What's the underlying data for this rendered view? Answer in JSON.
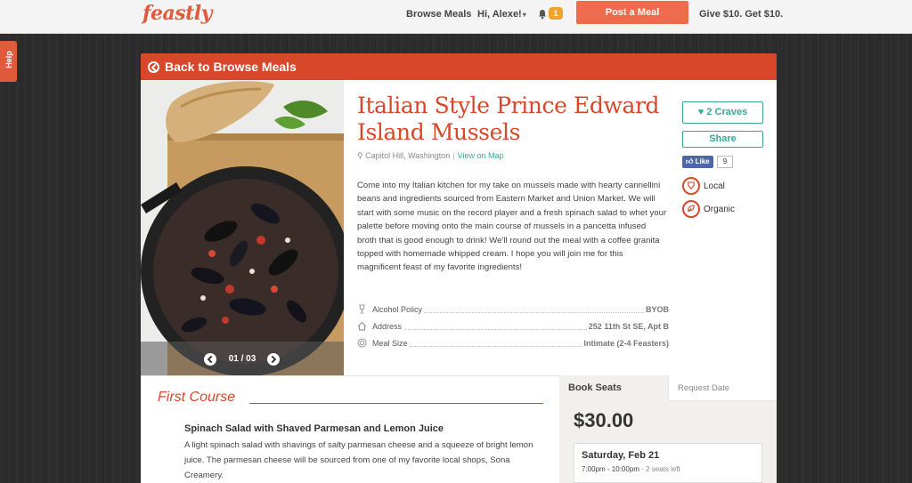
{
  "nav": {
    "logo": "feastly",
    "browse": "Browse Meals",
    "user": "Hi, Alexe!",
    "notifications": "1",
    "post": "Post a Meal",
    "give": "Give $10. Get $10."
  },
  "help": "Help",
  "card": {
    "back": "Back to Browse Meals",
    "title": "Italian Style Prince Edward Island Mussels",
    "location": "Capitol Hill, Washington",
    "map_link": "View on Map",
    "description": "Come into my Italian kitchen for my take on mussels made with hearty cannellini beans and ingredients sourced from Eastern Market and Union Market. We will start with some music on the record player and a fresh spinach salad to whet your palette before moving onto the main course of mussels in a pancetta infused broth that is good enough to drink! We'll round out the meal with a coffee granita topped with homemade whipped cream. I hope you will join me for this magnificent feast of my favorite ingredients!",
    "details": [
      {
        "label": "Alcohol Policy",
        "value": "BYOB",
        "icon": "glass-icon"
      },
      {
        "label": "Address",
        "value": "252 11th St SE, Apt B",
        "icon": "house-icon"
      },
      {
        "label": "Meal Size",
        "value": "Intimate (2-4 Feasters)",
        "icon": "plate-icon"
      }
    ],
    "carousel": "01 / 03"
  },
  "side": {
    "craves": "2 Craves",
    "share": "Share",
    "like": "Like",
    "like_count": "9",
    "tags": [
      {
        "label": "Local",
        "icon": "local-icon"
      },
      {
        "label": "Organic",
        "icon": "organic-icon"
      }
    ]
  },
  "course": {
    "heading": "First Course",
    "dish": "Spinach Salad with Shaved Parmesan and Lemon Juice",
    "dish_desc": "A light spinach salad with shavings of salty parmesan cheese and a squeeze of bright lemon juice. The parmesan cheese will be sourced from one of my favorite local shops, Sona Creamery."
  },
  "booking": {
    "tab_active": "Book Seats",
    "tab_other": "Request Date",
    "price": "$30.00",
    "date": "Saturday, Feb 21",
    "time": "7:00pm - 10:00pm",
    "seats": "- 2 seats left"
  },
  "colors": {
    "brand": "#d9472b",
    "accent": "#3aa79a",
    "post_button": "#ef6b4d",
    "badge": "#f0a32a"
  }
}
